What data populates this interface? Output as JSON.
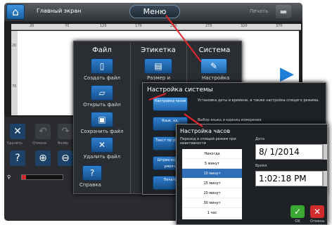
{
  "topbar": {
    "home_label": "Главный экран",
    "menu_label": "Меню",
    "print_label": "Печать"
  },
  "ruler": {
    "ticks": [
      "20",
      "70",
      "120",
      "170",
      "220",
      "270",
      "320",
      "370"
    ]
  },
  "vruler": {
    "ticks": [
      "20",
      "70"
    ]
  },
  "toolbar": {
    "delete_label": "Удалить",
    "undo_label": "Отмена",
    "redo_label": "Возвр"
  },
  "menu": {
    "file_header": "Файл",
    "label_header": "Этикетка",
    "system_header": "Система",
    "create_file": "Создать файл",
    "open_file": "Открыть файл",
    "save_file": "Сохранить файл",
    "delete_file": "Удалить файл",
    "help": "Справка",
    "size_label": "Размер и",
    "settings_label": "Настройка"
  },
  "system": {
    "title": "Настройка системы",
    "buttons": [
      "Настройка часов",
      "Язык, ед.",
      "Текст по умолч.",
      "Штрих-код по умолч.",
      "Печать"
    ],
    "desc1": "Установка даты и времени, а также настройка спящего режима.",
    "desc2": "Выбор языка и единиц измерения."
  },
  "clock": {
    "title": "Настройка часов",
    "sleep_label": "Переход в спящий режим при неактивности",
    "options": [
      "Никогда",
      "5 минут",
      "10 минут",
      "15 минут",
      "20 минут",
      "30 минут",
      "1 час"
    ],
    "selected_index": 2,
    "date_label": "Дата",
    "date_value": "8/ 1/2014",
    "time_label": "Время",
    "time_value": "1:02:18 PM",
    "ok_label": "OK",
    "cancel_label": "Отмена"
  },
  "colors": {
    "accent": "#2f7fd0",
    "arrow": "#e6262b",
    "ok": "#3aa832",
    "cancel": "#d22b2b"
  }
}
